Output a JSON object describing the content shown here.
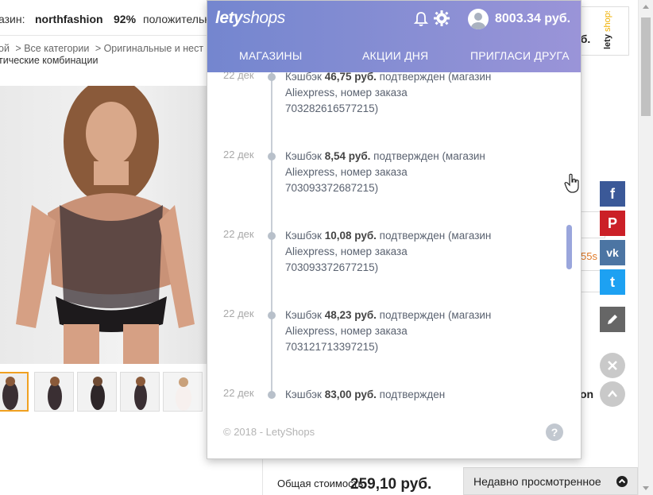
{
  "store": {
    "shop_label": "азин:",
    "shop_name": "northfashion",
    "rating": "92%",
    "rating_label": "положительн",
    "price_fragment": "уб.",
    "breadcrumb": [
      "ой",
      "> Все категории",
      "> Оригинальные и нест"
    ],
    "subtitle": "тические комбинации",
    "timer_fragment": "55s",
    "on_fragment": "on",
    "total_label": "Общая стоимость",
    "total_price": "259,10 руб.",
    "recently_viewed": "Недавно просмотренное"
  },
  "social": {
    "facebook": "f",
    "pinterest": "P",
    "vk": "vk",
    "twitter": "t"
  },
  "popup": {
    "logo_bold": "lety",
    "logo_rest": "shops",
    "balance": "8003.34 руб.",
    "tabs": [
      "МАГАЗИНЫ",
      "АКЦИИ ДНЯ",
      "ПРИГЛАСИ ДРУГА"
    ],
    "entries": [
      {
        "date": "22 дек",
        "prefix": "Кэшбэк ",
        "amount": "46,75 руб.",
        "status": " подтвержден",
        "detail": "(магазин Aliexpress, номер заказа 703282616577215)"
      },
      {
        "date": "22 дек",
        "prefix": "Кэшбэк ",
        "amount": "8,54 руб.",
        "status": " подтвержден",
        "detail": "(магазин Aliexpress, номер заказа 703093372687215)"
      },
      {
        "date": "22 дек",
        "prefix": "Кэшбэк ",
        "amount": "10,08 руб.",
        "status": " подтвержден",
        "detail": "(магазин Aliexpress, номер заказа 703093372677215)"
      },
      {
        "date": "22 дек",
        "prefix": "Кэшбэк ",
        "amount": "48,23 руб.",
        "status": " подтвержден",
        "detail": "(магазин Aliexpress, номер заказа 703121713397215)"
      },
      {
        "date": "22 дек",
        "prefix": "Кэшбэк ",
        "amount": "83,00 руб.",
        "status": " подтвержден",
        "detail": ""
      }
    ],
    "copyright": "© 2018 - LetyShops",
    "help": "?"
  },
  "colors": {
    "header_gradient_start": "#7486cf",
    "header_gradient_end": "#9a94d8",
    "thumb_selected": "#f0a020",
    "facebook": "#3b5998",
    "pinterest": "#cb2027",
    "vk": "#4c75a3",
    "twitter": "#1da1f2"
  }
}
